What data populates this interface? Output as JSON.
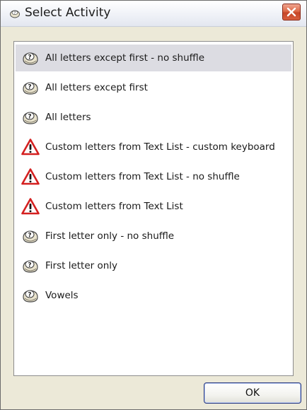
{
  "window": {
    "title": "Select Activity",
    "app_icon": "shuffle-app-icon"
  },
  "activities": [
    {
      "label": "All letters except first - no shuffle",
      "icon": "keyboard-help-icon",
      "selected": true
    },
    {
      "label": "All letters except first",
      "icon": "keyboard-help-icon"
    },
    {
      "label": "All letters",
      "icon": "keyboard-help-icon"
    },
    {
      "label": "Custom letters from Text List - custom keyboard",
      "icon": "warning-icon"
    },
    {
      "label": "Custom letters from Text List - no shuffle",
      "icon": "warning-icon"
    },
    {
      "label": "Custom letters from Text List",
      "icon": "warning-icon"
    },
    {
      "label": "First letter only - no shuffle",
      "icon": "keyboard-help-icon"
    },
    {
      "label": "First letter only",
      "icon": "keyboard-help-icon"
    },
    {
      "label": "Vowels",
      "icon": "keyboard-help-icon"
    }
  ],
  "buttons": {
    "ok": "OK"
  },
  "colors": {
    "selection": "#dcdce2",
    "warning": "#d42020",
    "close": "#d8603f"
  }
}
